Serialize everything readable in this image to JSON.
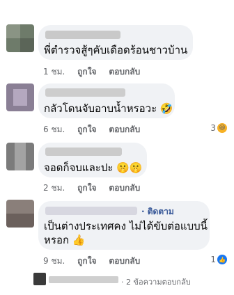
{
  "comments": [
    {
      "text": "พี่ตำรวจสู้ๆคับเดือดร้อนชาวบ้าน",
      "time": "1 ชม.",
      "like": "ถูกใจ",
      "reply": "ตอบกลับ"
    },
    {
      "text": "กลัวโดนจับอาบน้ำหรอวะ 🤣",
      "time": "6 ชม.",
      "like": "ถูกใจ",
      "reply": "ตอบกลับ",
      "reaction_count": "3",
      "reaction_icon": "haha-emoji-icon"
    },
    {
      "text": "จอดก็จบและปะ 🤫🤫",
      "time": "2 ชม.",
      "like": "ถูกใจ",
      "reply": "ตอบกลับ"
    },
    {
      "text_line1": "เป็นต่างประเทศคง ไม่ได้ขับต่อแบบนี้",
      "text_line2": "หรอก 👍",
      "follow": "· ติดตาม",
      "time": "9 ชม.",
      "like": "ถูกใจ",
      "reply": "ตอบกลับ",
      "reaction_count": "1",
      "reaction_icon": "like-icon"
    }
  ],
  "replies_link": "· 2 ข้อความตอบกลับ",
  "colors": {
    "bubble": "#f0f2f5",
    "meta": "#65676b",
    "follow": "#385898",
    "like_blue": "#1877f2"
  }
}
